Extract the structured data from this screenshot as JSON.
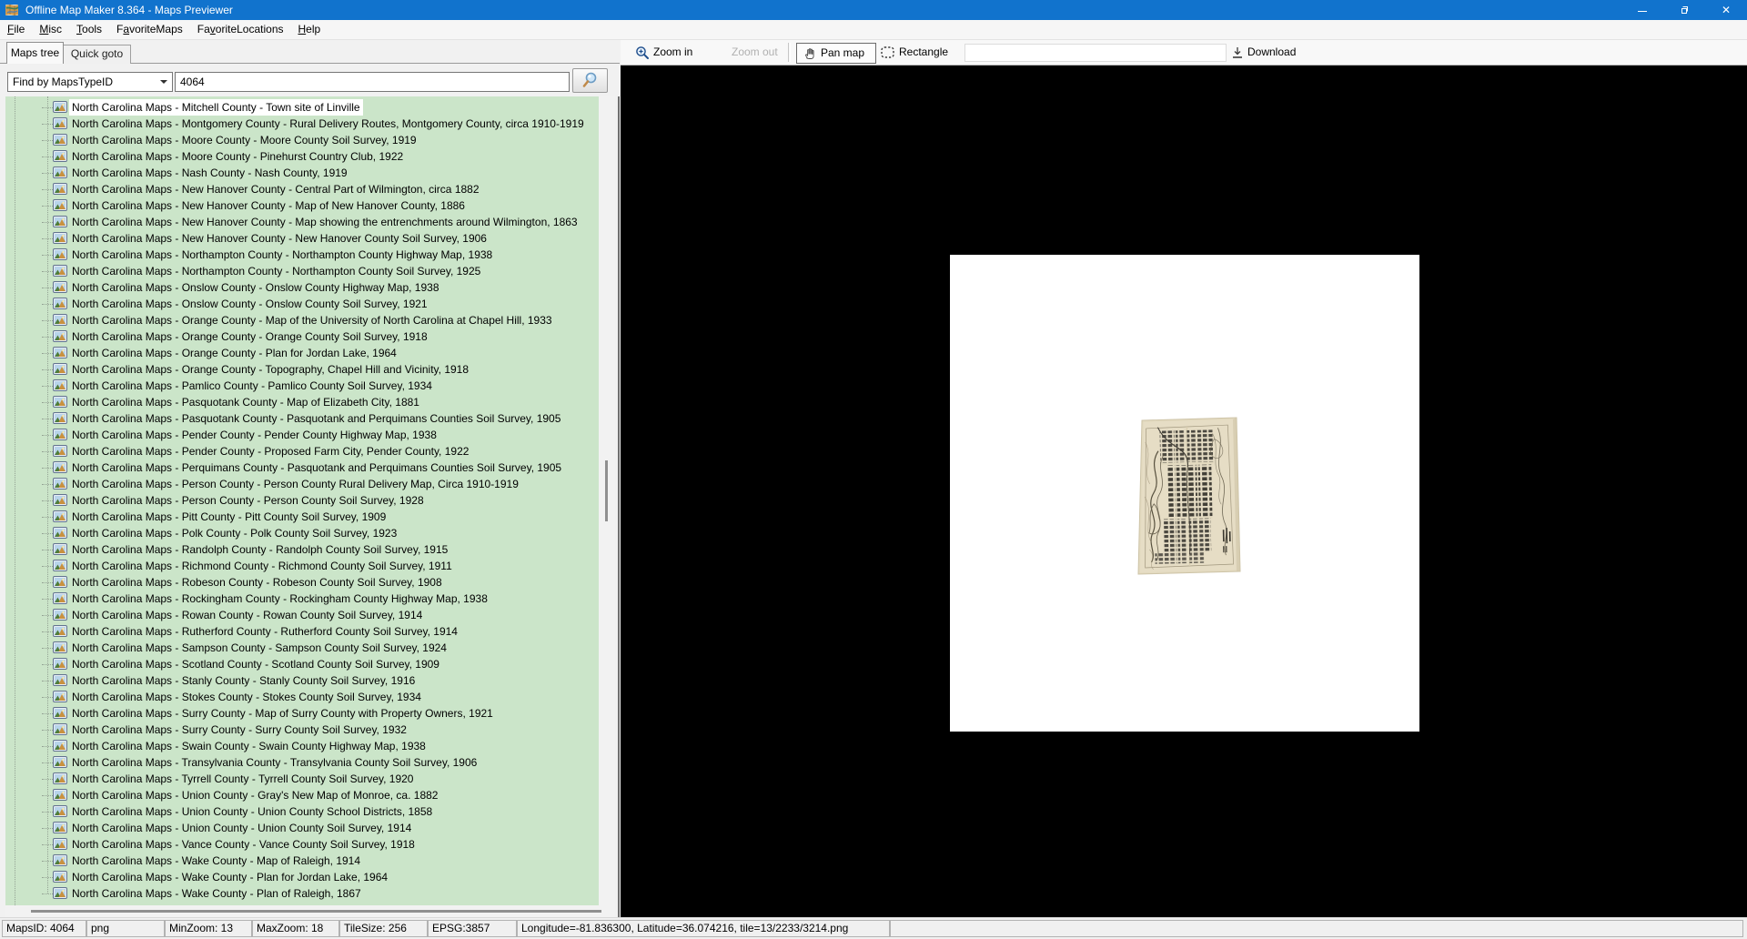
{
  "window": {
    "title": "Offline Map Maker 8.364 - Maps Previewer",
    "controls": {
      "minimize": "minimize",
      "restore": "restore",
      "close": "close"
    }
  },
  "menu": {
    "items": [
      {
        "label": "File",
        "u": 0
      },
      {
        "label": "Misc",
        "u": 0
      },
      {
        "label": "Tools",
        "u": 0
      },
      {
        "label": "FavoriteMaps",
        "u": 1
      },
      {
        "label": "FavoriteLocations",
        "u": 2
      },
      {
        "label": "Help",
        "u": 0
      }
    ]
  },
  "tabs": {
    "maps_tree": "Maps tree",
    "quick_goto": "Quick goto"
  },
  "search": {
    "filter_value": "Find by MapsTypeID",
    "query_value": "4064"
  },
  "toolbar": {
    "zoom_in": "Zoom in",
    "zoom_out": "Zoom out",
    "pan_map": "Pan map",
    "rectangle": "Rectangle",
    "download": "Download"
  },
  "tree": {
    "selected_index": 0,
    "items": [
      "North Carolina Maps - Mitchell County - Town site of Linville",
      "North Carolina Maps - Montgomery County - Rural Delivery Routes, Montgomery County, circa 1910-1919",
      "North Carolina Maps - Moore County - Moore County Soil Survey, 1919",
      "North Carolina Maps - Moore County - Pinehurst Country Club, 1922",
      "North Carolina Maps - Nash County - Nash County, 1919",
      "North Carolina Maps - New Hanover County - Central Part of Wilmington, circa 1882",
      "North Carolina Maps - New Hanover County - Map of New Hanover County, 1886",
      "North Carolina Maps - New Hanover County - Map showing the entrenchments around Wilmington, 1863",
      "North Carolina Maps - New Hanover County - New Hanover County Soil Survey, 1906",
      "North Carolina Maps - Northampton County - Northampton County Highway Map, 1938",
      "North Carolina Maps - Northampton County - Northampton County Soil Survey, 1925",
      "North Carolina Maps - Onslow County - Onslow County Highway Map, 1938",
      "North Carolina Maps - Onslow County - Onslow County Soil Survey, 1921",
      "North Carolina Maps - Orange County - Map of the University of North Carolina at Chapel Hill, 1933",
      "North Carolina Maps - Orange County - Orange County Soil Survey, 1918",
      "North Carolina Maps - Orange County - Plan for Jordan Lake, 1964",
      "North Carolina Maps - Orange County - Topography, Chapel Hill and Vicinity, 1918",
      "North Carolina Maps - Pamlico County - Pamlico County Soil Survey, 1934",
      "North Carolina Maps - Pasquotank County - Map of Elizabeth City, 1881",
      "North Carolina Maps - Pasquotank County - Pasquotank and Perquimans Counties Soil Survey, 1905",
      "North Carolina Maps - Pender County - Pender County Highway Map, 1938",
      "North Carolina Maps - Pender County - Proposed Farm City, Pender County, 1922",
      "North Carolina Maps - Perquimans County - Pasquotank and Perquimans Counties Soil Survey, 1905",
      "North Carolina Maps - Person County - Person County Rural Delivery Map, Circa 1910-1919",
      "North Carolina Maps - Person County - Person County Soil Survey, 1928",
      "North Carolina Maps - Pitt County - Pitt County Soil Survey, 1909",
      "North Carolina Maps - Polk County - Polk County Soil Survey, 1923",
      "North Carolina Maps - Randolph County - Randolph County Soil Survey, 1915",
      "North Carolina Maps - Richmond County - Richmond County Soil Survey, 1911",
      "North Carolina Maps - Robeson County - Robeson County Soil Survey, 1908",
      "North Carolina Maps - Rockingham County - Rockingham County Highway Map, 1938",
      "North Carolina Maps - Rowan County - Rowan County Soil Survey, 1914",
      "North Carolina Maps - Rutherford County - Rutherford County Soil Survey, 1914",
      "North Carolina Maps - Sampson County - Sampson County Soil Survey, 1924",
      "North Carolina Maps - Scotland County - Scotland County Soil Survey, 1909",
      "North Carolina Maps - Stanly County - Stanly County Soil Survey, 1916",
      "North Carolina Maps - Stokes County - Stokes County Soil Survey, 1934",
      "North Carolina Maps - Surry County - Map of Surry County with Property Owners, 1921",
      "North Carolina Maps - Surry County - Surry County Soil Survey, 1932",
      "North Carolina Maps - Swain County - Swain County Highway Map, 1938",
      "North Carolina Maps - Transylvania County - Transylvania County Soil Survey, 1906",
      "North Carolina Maps - Tyrrell County - Tyrrell County Soil Survey, 1920",
      "North Carolina Maps - Union County - Gray's New Map of Monroe, ca. 1882",
      "North Carolina Maps - Union County - Union County School Districts, 1858",
      "North Carolina Maps - Union County - Union County Soil Survey, 1914",
      "North Carolina Maps - Vance County - Vance County Soil Survey, 1918",
      "North Carolina Maps - Wake County - Map of Raleigh, 1914",
      "North Carolina Maps - Wake County - Plan for Jordan Lake, 1964",
      "North Carolina Maps - Wake County - Plan of Raleigh, 1867"
    ]
  },
  "statusbar": {
    "panels": [
      "MapsID: 4064",
      "png",
      "MinZoom: 13",
      "MaxZoom: 18",
      "TileSize: 256",
      "EPSG:3857",
      "Longitude=-81.836300, Latitude=36.074216, tile=13/2233/3214.png",
      ""
    ]
  }
}
